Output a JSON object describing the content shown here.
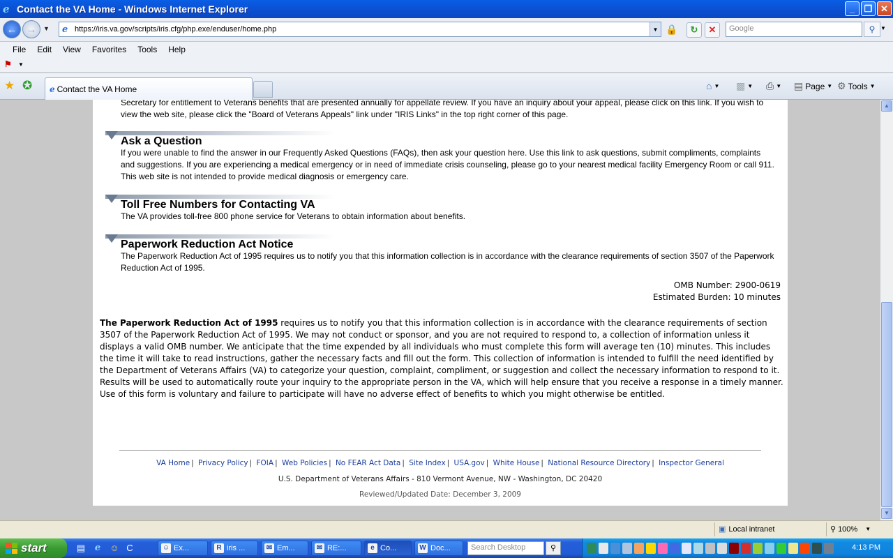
{
  "window": {
    "title": "Contact the VA Home - Windows Internet Explorer",
    "minimize": "_",
    "maximize": "❐",
    "close": "✕"
  },
  "nav": {
    "url": "https://iris.va.gov/scripts/iris.cfg/php.exe/enduser/home.php",
    "search_placeholder": "Google"
  },
  "menu": [
    "File",
    "Edit",
    "View",
    "Favorites",
    "Tools",
    "Help"
  ],
  "tabs": {
    "active_tab": "Contact the VA Home",
    "commands": {
      "page": "Page",
      "tools": "Tools"
    }
  },
  "content": {
    "intro_partial": "Secretary for entitlement to Veterans benefits that are presented annually for appellate review. If you have an inquiry about your appeal, please click on this link. If you wish to view the web site, please click the \"Board of Veterans Appeals\" link under \"IRIS Links\" in the top right corner of this page.",
    "sections": [
      {
        "heading": "Ask a Question",
        "text": "If you were unable to find the answer in our Frequently Asked Questions (FAQs), then ask your question here. Use this link to ask questions, submit compliments, complaints and suggestions. If you are experiencing a medical emergency or in need of immediate crisis counseling, please go to your nearest medical facility Emergency Room or call 911. This web site is not intended to provide medical diagnosis or emergency care."
      },
      {
        "heading": "Toll Free Numbers for Contacting VA",
        "text": "The VA provides toll-free 800 phone service for Veterans to obtain information about benefits."
      },
      {
        "heading": "Paperwork Reduction Act Notice",
        "text": "The Paperwork Reduction Act of 1995 requires us to notify you that this information collection is in accordance with the clearance requirements of section 3507 of the Paperwork Reduction Act of 1995."
      }
    ],
    "omb_number": "OMB Number: 2900-0619",
    "estimated_burden": "Estimated Burden: 10 minutes",
    "pra_bold": "The Paperwork Reduction Act of 1995",
    "pra_text": " requires us to notify you that this information collection is in accordance with the clearance requirements of section 3507 of the Paperwork Reduction Act of 1995. We may not conduct or sponsor, and you are not required to respond to, a collection of information unless it displays a valid OMB number. We anticipate that the time expended by all individuals who must complete this form will average ten (10) minutes. This includes the time it will take to read instructions, gather the necessary facts and fill out the form. This collection of information is intended to fulfill the need identified by the Department of Veterans Affairs (VA) to categorize your question, complaint, compliment, or suggestion and collect the necessary information to respond to it. Results will be used to automatically route your inquiry to the appropriate person in the VA, which will help ensure that you receive a response in a timely manner. Use of this form is voluntary and failure to participate will have no adverse effect of benefits to which you might otherwise be entitled."
  },
  "footer": {
    "links": [
      "VA Home",
      "Privacy Policy",
      "FOIA",
      "Web Policies",
      "No FEAR Act Data",
      "Site Index",
      "USA.gov",
      "White House",
      "National Resource Directory",
      "Inspector General"
    ],
    "address": "U.S. Department of Veterans Affairs - 810 Vermont Avenue, NW - Washington, DC 20420",
    "reviewed": "Reviewed/Updated Date: December 3, 2009"
  },
  "status": {
    "zone": "Local intranet",
    "zoom": "100%"
  },
  "taskbar": {
    "start": "start",
    "tasks": [
      "Ex...",
      "iris ...",
      "Em...",
      "RE:...",
      "Co...",
      "Doc..."
    ],
    "desktop_search_placeholder": "Search Desktop",
    "clock": "4:13 PM"
  },
  "colors": {
    "link": "#1a3e9c",
    "xp_blue": "#245ed9",
    "start_green": "#3a9a33"
  }
}
